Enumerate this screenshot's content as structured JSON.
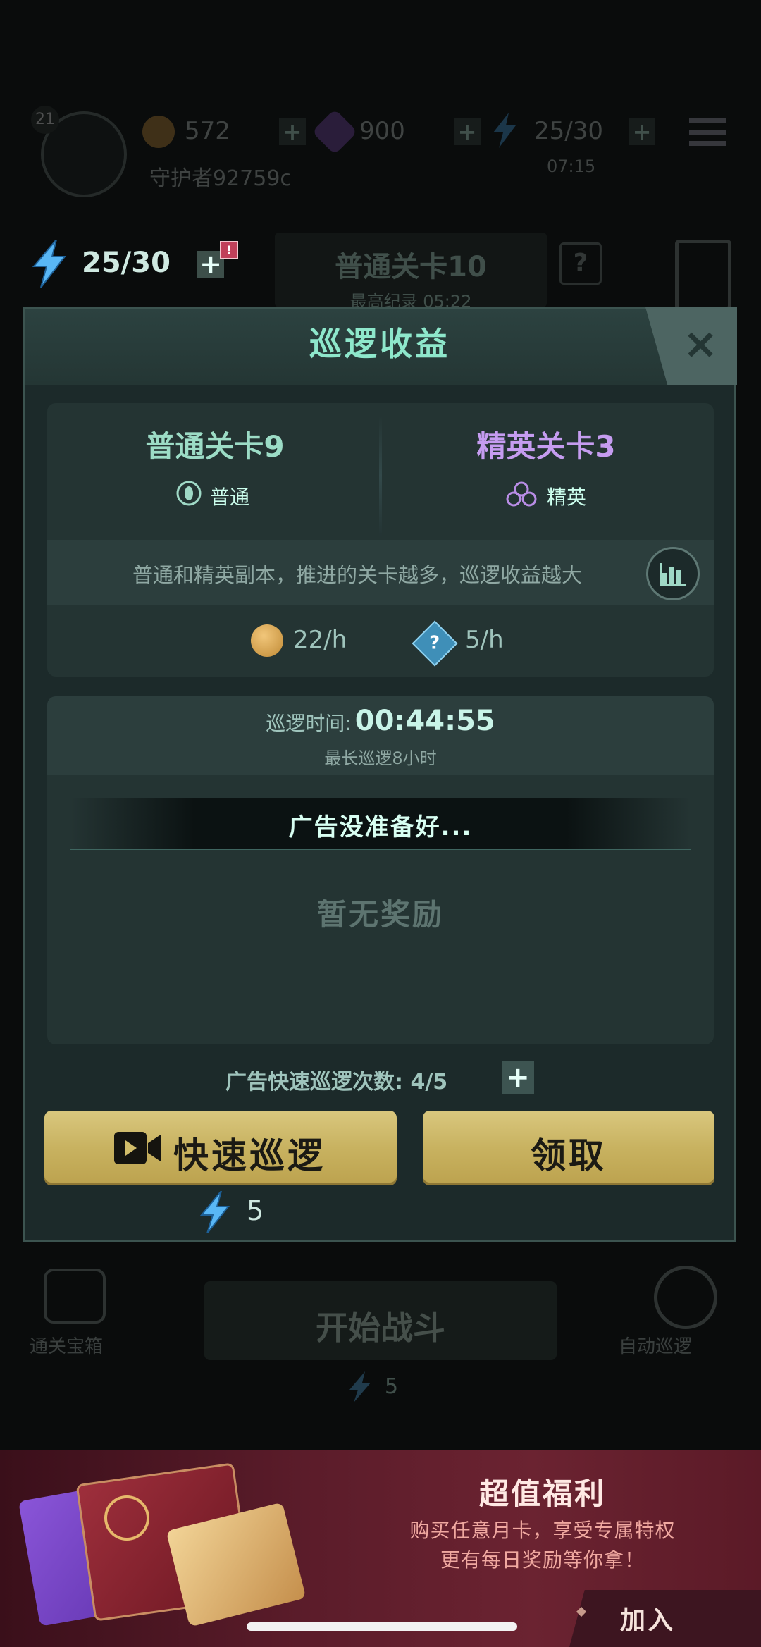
{
  "colors": {
    "accent_teal": "#8ee7cb",
    "elite_purple": "#c59cf0",
    "gold_button": "#d2bd6a",
    "modal_bg": "#1c2a2a"
  },
  "hud": {
    "level": "21",
    "gold": "572",
    "gems": "900",
    "energy": "25/30",
    "energy_timer": "07:15",
    "player_name": "守护者92759c",
    "stage_button": "普通关卡10",
    "stage_sub": "最高纪录 05:22",
    "question": "?"
  },
  "energy_bar": {
    "value": "25/30",
    "badge": "!"
  },
  "modal": {
    "title": "巡逻收益",
    "close_icon": "×",
    "normal_stage": {
      "name": "普通关卡9",
      "difficulty": "普通"
    },
    "elite_stage": {
      "name": "精英关卡3",
      "difficulty": "精英"
    },
    "info": "普通和精英副本，推进的关卡越多，巡逻收益越大",
    "rates": [
      {
        "icon": "coin-icon",
        "value": "22/h"
      },
      {
        "icon": "mystery-crystal-icon",
        "value": "5/h"
      }
    ],
    "timer": {
      "label": "巡逻时间:",
      "value": "00:44:55",
      "max": "最长巡逻8小时"
    },
    "ad_status": "广告没准备好...",
    "no_reward": "暂无奖励",
    "ad_count": "广告快速巡逻次数: 4/5",
    "quick_patrol": "快速巡逻",
    "claim": "领取",
    "quick_cost": "5"
  },
  "bottom": {
    "chest_label": "通关宝箱",
    "start_button": "开始战斗",
    "start_cost": "5",
    "auto_label": "自动巡逻"
  },
  "promo": {
    "title": "超值福利",
    "line1": "购买任意月卡，享受专属特权",
    "line2": "更有每日奖励等你拿！",
    "join": "加入"
  }
}
